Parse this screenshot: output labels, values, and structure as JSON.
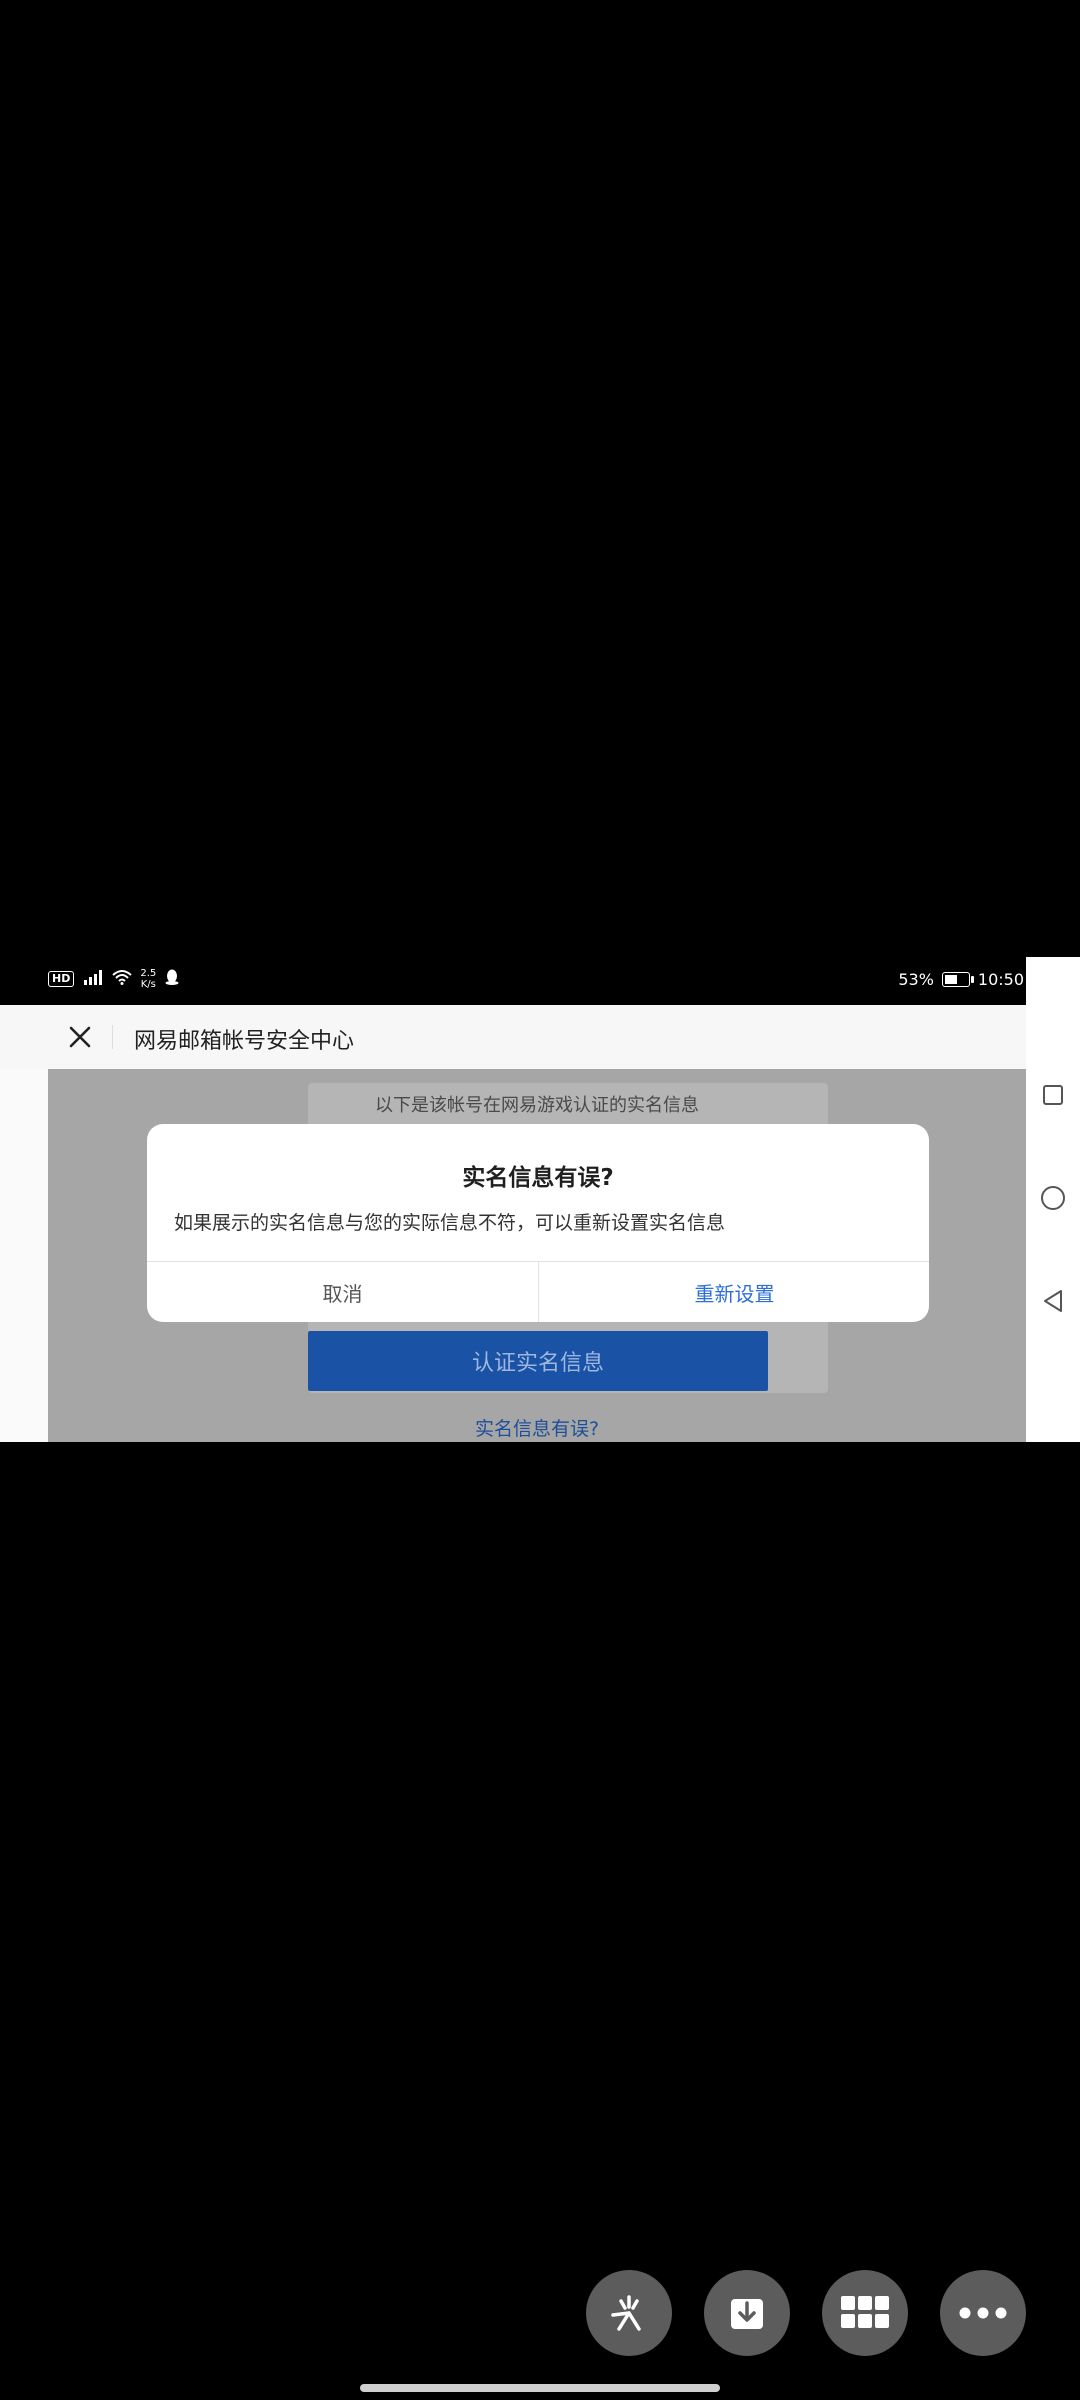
{
  "status_bar": {
    "hd": "HD",
    "net_speed_value": "2.5",
    "net_speed_unit": "K/s",
    "battery_percent": "53%",
    "battery_level": 0.53,
    "time": "10:50"
  },
  "header": {
    "title": "网易邮箱帐号安全中心"
  },
  "background": {
    "description": "以下是该帐号在网易游戏认证的实名信息",
    "verify_button_label": "认证实名信息",
    "error_link": "实名信息有误?"
  },
  "dialog": {
    "title": "实名信息有误?",
    "message": "如果展示的实名信息与您的实际信息不符，可以重新设置实名信息",
    "cancel_label": "取消",
    "confirm_label": "重新设置"
  },
  "navbar": {
    "icons": [
      "recents-square-icon",
      "home-circle-icon",
      "back-triangle-icon"
    ]
  },
  "floating_buttons": {
    "icons": [
      "sparkle-icon",
      "download-icon",
      "grid-icon",
      "more-icon"
    ]
  },
  "colors": {
    "accent": "#2e6fd6",
    "verify_button": "#1a52a6",
    "overlay": "#a6a6a6"
  }
}
